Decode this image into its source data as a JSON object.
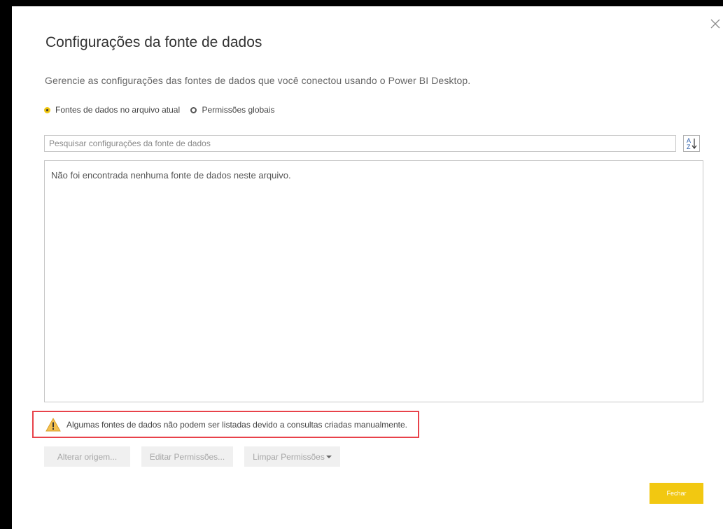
{
  "dialog": {
    "title": "Configurações da fonte de dados",
    "subtitle": "Gerencie as configurações das fontes de dados que você conectou usando o Power BI Desktop.",
    "close_icon": "close-icon"
  },
  "scope": {
    "options": [
      {
        "label": "Fontes de dados no arquivo atual",
        "selected": true
      },
      {
        "label": "Permissões globais",
        "selected": false
      }
    ]
  },
  "search": {
    "placeholder": "Pesquisar configurações da fonte de dados",
    "value": "",
    "sort_icon": "sort-az-icon"
  },
  "list": {
    "empty_message": "Não foi encontrada nenhuma fonte de dados neste arquivo."
  },
  "warning": {
    "icon": "warning-icon",
    "text": "Algumas fontes de dados não podem ser listadas devido a consultas criadas manualmente.",
    "highlight_color": "#e8424a"
  },
  "actions": {
    "change_source_label": "Alterar origem...",
    "edit_permissions_label": "Editar Permissões...",
    "clear_permissions_label": "Limpar Permissões",
    "close_label": "Fechar"
  },
  "colors": {
    "accent": "#f2c811",
    "disabled_button_bg": "#f0f0f0",
    "disabled_button_text": "#a6a6a6"
  }
}
